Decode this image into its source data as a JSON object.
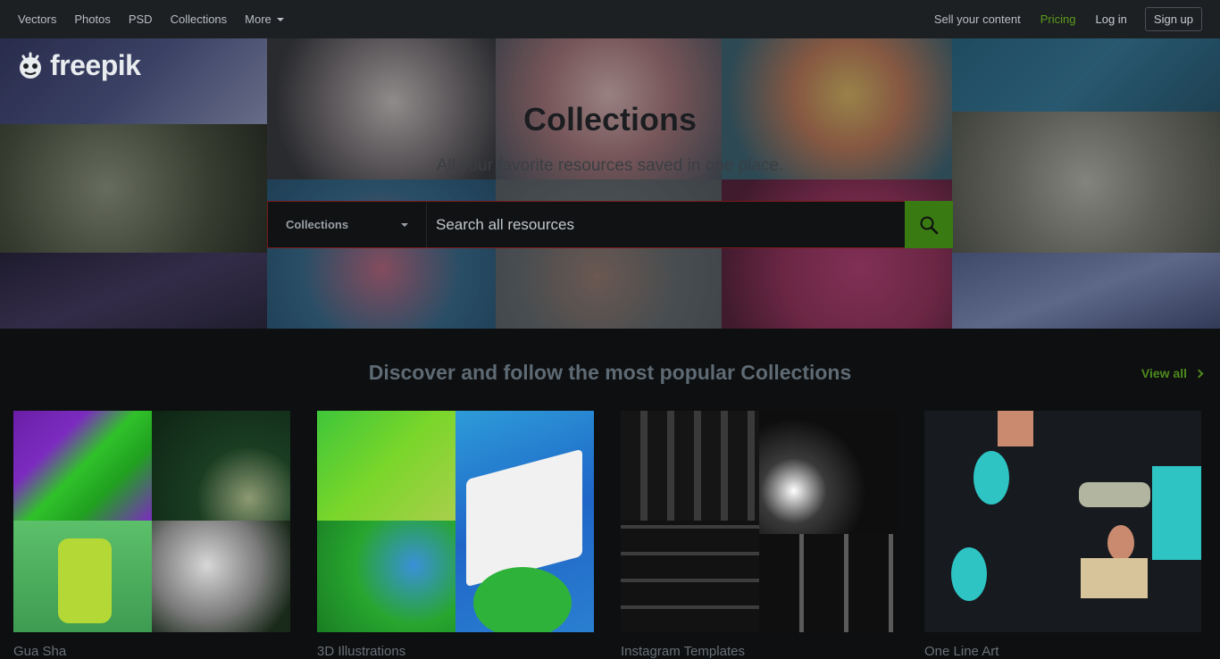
{
  "nav": {
    "left": [
      "Vectors",
      "Photos",
      "PSD",
      "Collections",
      "More"
    ],
    "sell": "Sell your content",
    "pricing": "Pricing",
    "login": "Log in",
    "signup": "Sign up"
  },
  "hero": {
    "logo_text": "freepik",
    "title": "Collections",
    "subtitle": "All your favorite resources saved in one place.",
    "search": {
      "filter": "Collections",
      "placeholder": "Search all resources"
    }
  },
  "section": {
    "title": "Discover and follow the most popular Collections",
    "view_all": "View all"
  },
  "collections": [
    {
      "name": "Gua Sha"
    },
    {
      "name": "3D Illustrations"
    },
    {
      "name": "Instagram Templates"
    },
    {
      "name": "One Line Art"
    }
  ],
  "colors": {
    "accent_green": "#3a7a12",
    "pricing_green": "#5b9c1d",
    "nav_bg": "#1d2023"
  }
}
